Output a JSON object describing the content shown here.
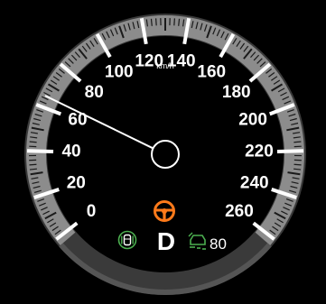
{
  "speedometer": {
    "unit": "km/h",
    "range": [
      0,
      260
    ],
    "major_ticks": [
      "0",
      "20",
      "40",
      "60",
      "80",
      "100",
      "120",
      "140",
      "160",
      "180",
      "200",
      "220",
      "240",
      "260"
    ],
    "needle_value": 65,
    "gear": "D",
    "cruise_set_speed": "80",
    "colors": {
      "background": "#000000",
      "bezel": "#8a8a8a",
      "needle": "#ffffff",
      "steering_warning": "#ff7a1a",
      "lane_assist": "#4caf50",
      "cruise": "#4caf50"
    },
    "icons": [
      "steering-wheel-icon",
      "lane-assist-car-icon",
      "adaptive-cruise-icon"
    ]
  }
}
